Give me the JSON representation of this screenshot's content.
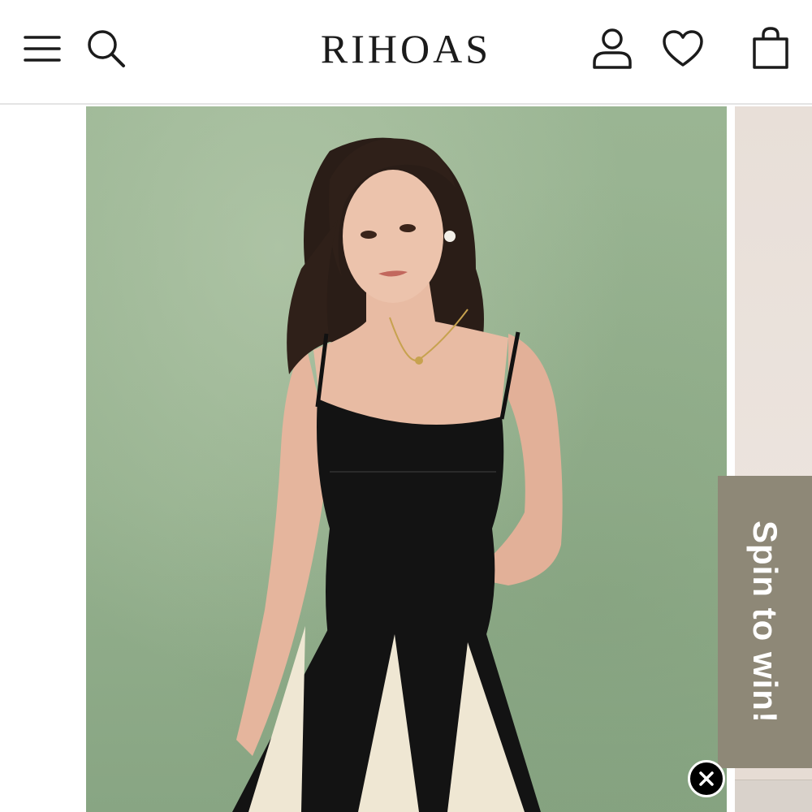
{
  "header": {
    "brand": "RIHOAS",
    "icons": {
      "menu": "menu-icon",
      "search": "search-icon",
      "account": "user-icon",
      "wishlist": "heart-icon",
      "bag": "shopping-bag-icon"
    }
  },
  "hero": {
    "background_color": "#93ad8c"
  },
  "promo": {
    "spin_label": "Spin to win!",
    "tab_color": "#8e8877",
    "close_icon": "close-icon"
  }
}
